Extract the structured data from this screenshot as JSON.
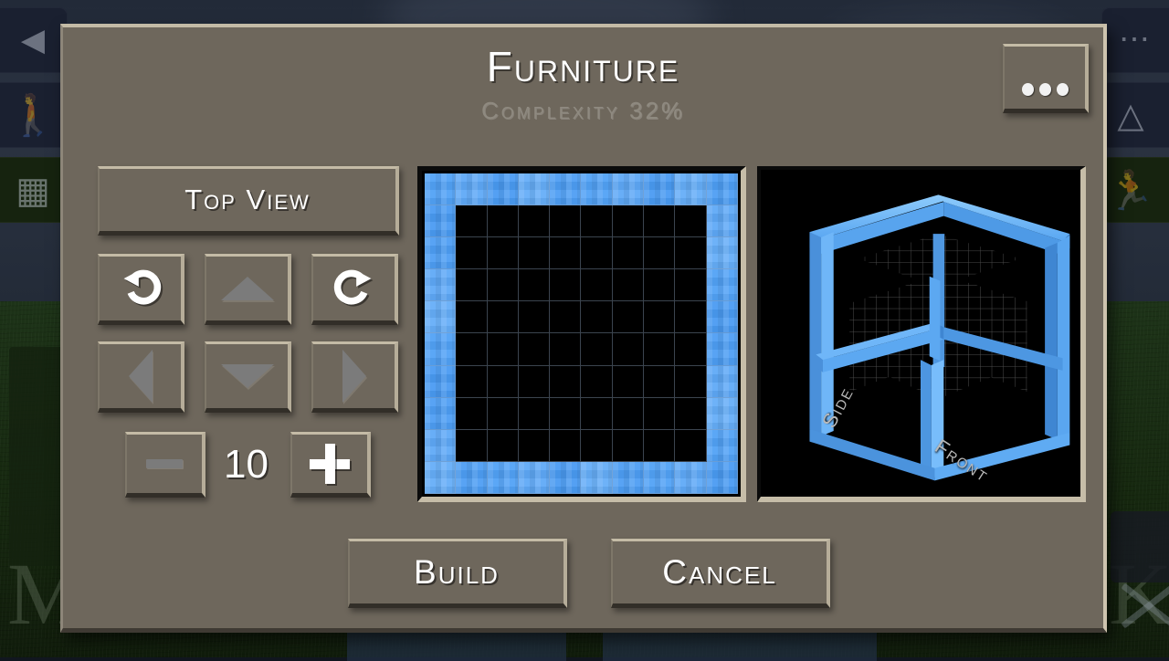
{
  "dialog": {
    "title": "Furniture",
    "subtitle_label": "Complexity",
    "complexity": "32%",
    "subtitle": "Complexity  32%",
    "overflow_button": "...",
    "colors": {
      "panel": "#6e675c",
      "panel_highlight": "#c4bba6",
      "panel_shadow": "#322e28",
      "blueprint_fill": "#52a2f6",
      "blueprint_empty": "#000000",
      "text": "#ffffff",
      "text_muted": "#8f8a80"
    }
  },
  "controls": {
    "view_button": "Top View",
    "undo": "undo-icon",
    "redo": "redo-icon",
    "up": "arrow-up-icon",
    "down": "arrow-down-icon",
    "left": "arrow-left-icon",
    "right": "arrow-right-icon",
    "decrease": "minus-icon",
    "increase": "plus-icon",
    "size_value": "10"
  },
  "blueprint": {
    "rows": 10,
    "cols": 10,
    "cells": [
      [
        1,
        1,
        1,
        1,
        1,
        1,
        1,
        1,
        1,
        1
      ],
      [
        1,
        0,
        0,
        0,
        0,
        0,
        0,
        0,
        0,
        1
      ],
      [
        1,
        0,
        0,
        0,
        0,
        0,
        0,
        0,
        0,
        1
      ],
      [
        1,
        0,
        0,
        0,
        0,
        0,
        0,
        0,
        0,
        1
      ],
      [
        1,
        0,
        0,
        0,
        0,
        0,
        0,
        0,
        0,
        1
      ],
      [
        1,
        0,
        0,
        0,
        0,
        0,
        0,
        0,
        0,
        1
      ],
      [
        1,
        0,
        0,
        0,
        0,
        0,
        0,
        0,
        0,
        1
      ],
      [
        1,
        0,
        0,
        0,
        0,
        0,
        0,
        0,
        0,
        1
      ],
      [
        1,
        0,
        0,
        0,
        0,
        0,
        0,
        0,
        0,
        1
      ],
      [
        1,
        1,
        1,
        1,
        1,
        1,
        1,
        1,
        1,
        1
      ]
    ]
  },
  "preview": {
    "side_label": "Side",
    "front_label": "Front"
  },
  "actions": {
    "build": "Build",
    "cancel": "Cancel"
  },
  "background": {
    "left_letter": "M",
    "right_letter": "K",
    "hud_left": [
      "back-arrow-icon",
      "person-icon",
      "window-icon"
    ],
    "hud_right": [
      "ellipsis-icon",
      "roof-icon",
      "running-person-icon"
    ]
  }
}
